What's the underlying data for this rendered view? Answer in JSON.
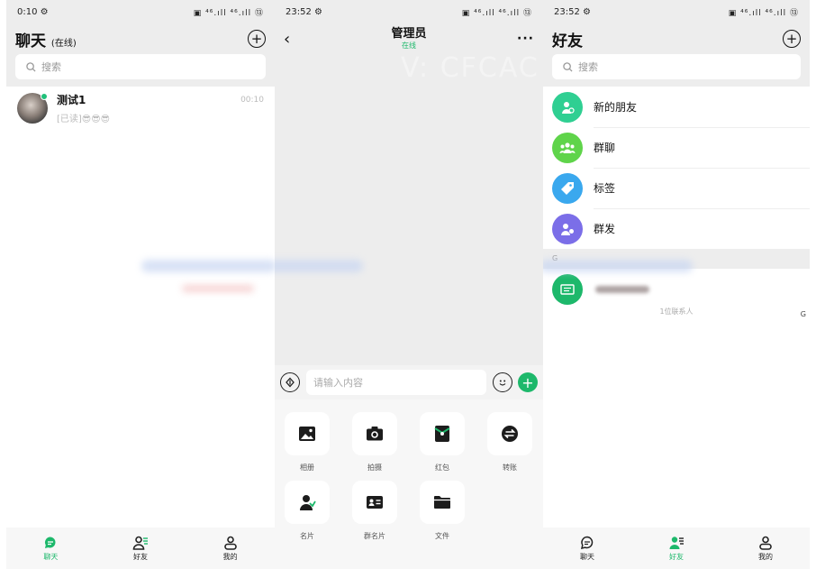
{
  "chats": {
    "status": {
      "time": "0:10 ⚙",
      "icons": "▣ ⁴⁶.ıll ⁴⁶.ıll ⑬"
    },
    "title": "聊天",
    "subtitle": "(在线)",
    "search_placeholder": "搜索",
    "items": [
      {
        "name": "测试1",
        "preview": "[已读]😎😎😎",
        "time": "00:10"
      }
    ]
  },
  "conversation": {
    "status": {
      "time": "23:52 ⚙",
      "icons": "▣ ⁴⁶.ıll ⁴⁶.ıll ⑬"
    },
    "back": "‹",
    "title": "管理员",
    "subtitle": "在线",
    "more": "···",
    "watermark": "V: CFCAC",
    "input_placeholder": "请输入内容",
    "tools": [
      {
        "label": "相册",
        "icon": "photo-icon"
      },
      {
        "label": "拍摄",
        "icon": "camera-icon"
      },
      {
        "label": "红包",
        "icon": "red-packet-icon"
      },
      {
        "label": "转账",
        "icon": "transfer-icon"
      },
      {
        "label": "名片",
        "icon": "contact-card-icon"
      },
      {
        "label": "群名片",
        "icon": "group-card-icon"
      },
      {
        "label": "文件",
        "icon": "folder-icon"
      }
    ]
  },
  "friends": {
    "status": {
      "time": "23:52 ⚙",
      "icons": "▣ ⁴⁶.ıll ⁴⁶.ıll ⑬"
    },
    "title": "好友",
    "search_placeholder": "搜索",
    "items": [
      {
        "label": "新的朋友",
        "icon": "new-friend-icon",
        "color": "#2fcf92"
      },
      {
        "label": "群聊",
        "icon": "group-chat-icon",
        "color": "#5fd44a"
      },
      {
        "label": "标签",
        "icon": "tag-icon",
        "color": "#3aa8ee"
      },
      {
        "label": "群发",
        "icon": "broadcast-icon",
        "color": "#7b6ee8"
      }
    ],
    "section_letter": "G",
    "count_text": "1位联系人",
    "index_letter": "G"
  },
  "tabbar": {
    "tabs": [
      {
        "label": "聊天"
      },
      {
        "label": "好友"
      },
      {
        "label": "我的"
      }
    ]
  },
  "colors": {
    "accent": "#1db86b",
    "background": "#ededed"
  }
}
